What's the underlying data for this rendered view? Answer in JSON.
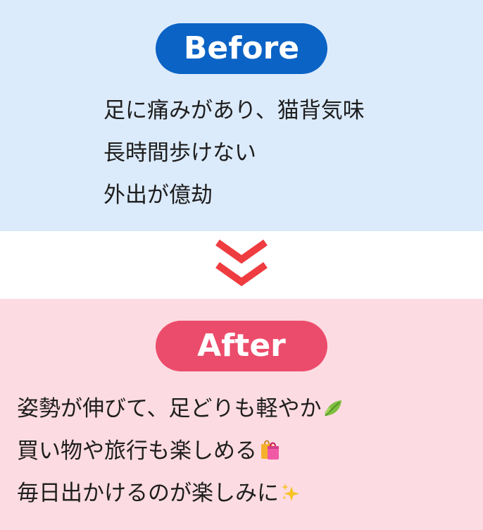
{
  "before": {
    "badge": "Before",
    "lines": [
      "足に痛みがあり、猫背気味",
      "長時間歩けない",
      "外出が億劫"
    ]
  },
  "after": {
    "badge": "After",
    "lines": [
      {
        "text": "姿勢が伸びて、足どりも軽やか",
        "emoji": "leaf-icon"
      },
      {
        "text": "買い物や旅行も楽しめる",
        "emoji": "shopping-bags-icon"
      },
      {
        "text": "毎日出かけるのが楽しみに",
        "emoji": "sparkles-icon"
      }
    ]
  },
  "colors": {
    "before_bg": "#dcebfb",
    "before_badge": "#0b63c5",
    "after_bg": "#fcdbe2",
    "after_badge": "#ec4c6b",
    "arrow": "#ee3c40"
  }
}
